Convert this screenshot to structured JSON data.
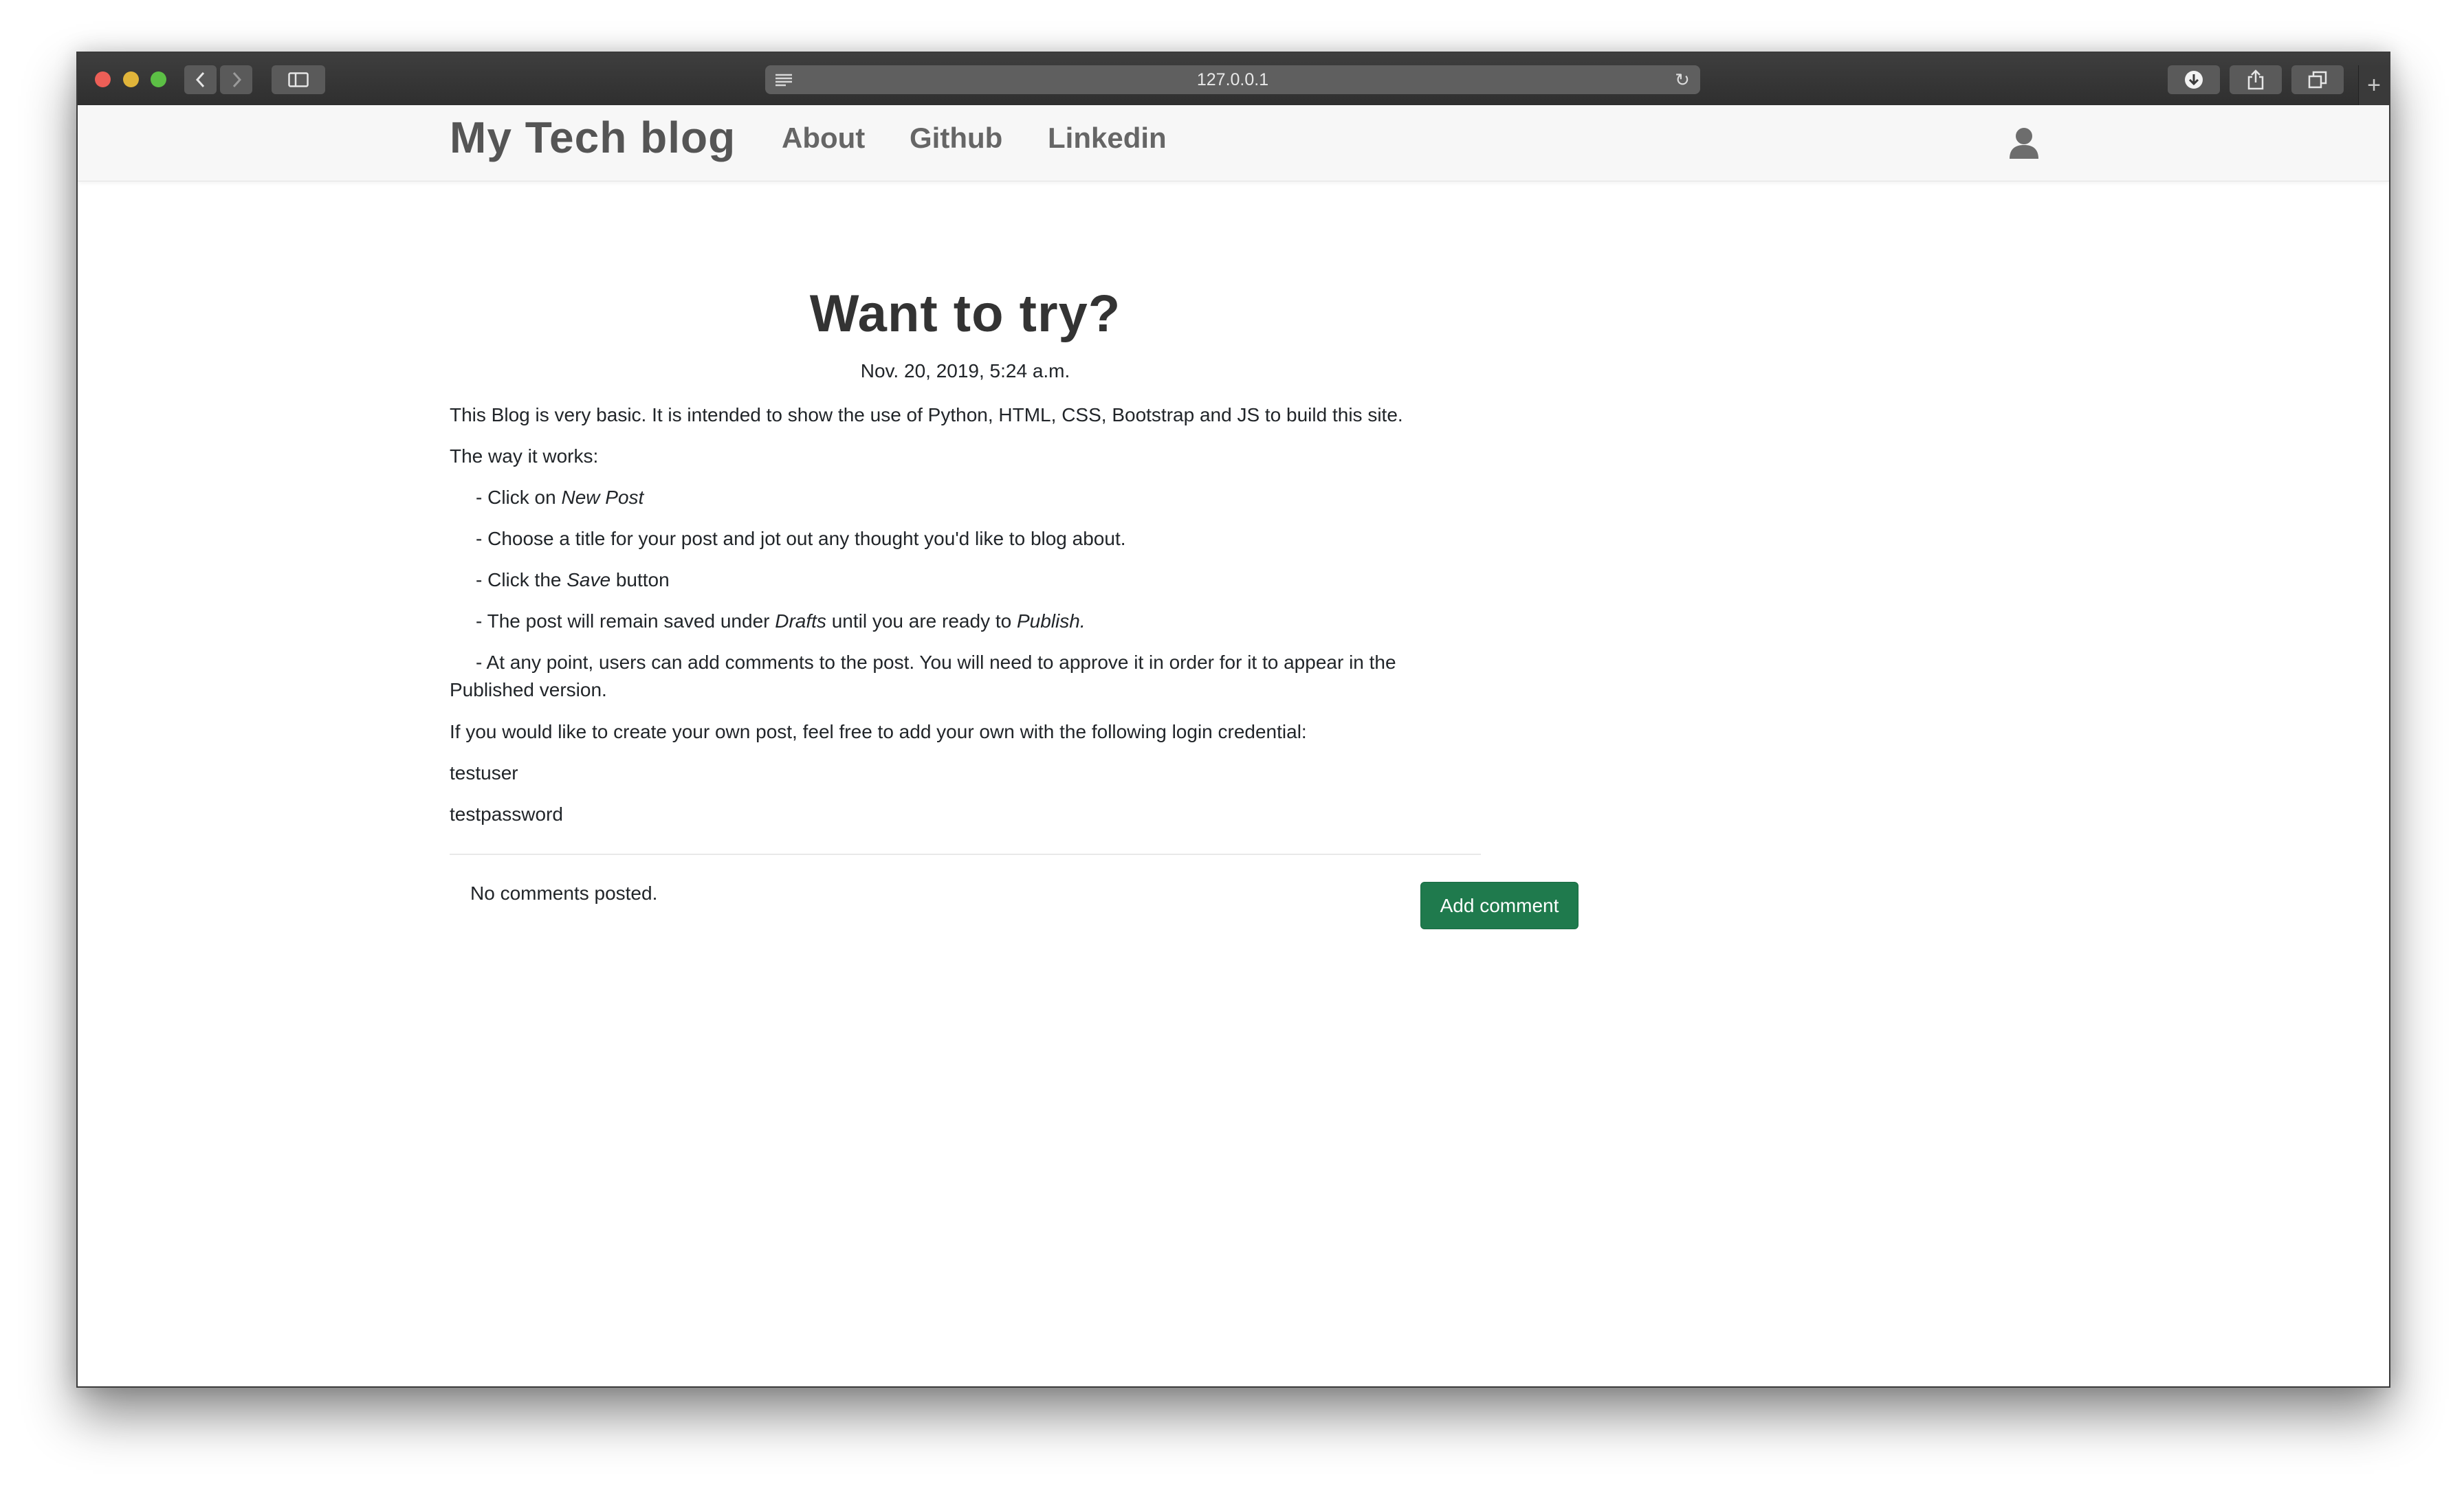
{
  "browser": {
    "url": "127.0.0.1",
    "icons": {
      "back": "chevron-left-icon",
      "forward": "chevron-right-icon",
      "sidebar": "sidebar-icon",
      "reader": "reader-icon",
      "reload": "reload-icon",
      "download": "download-icon",
      "share": "share-icon",
      "tabs": "tabs-icon",
      "new_tab": "plus-icon"
    }
  },
  "navbar": {
    "brand": "My Tech blog",
    "links": [
      "About",
      "Github",
      "Linkedin"
    ],
    "user_icon": "user-icon"
  },
  "post": {
    "title": "Want to try?",
    "date": "Nov. 20, 2019, 5:24 a.m.",
    "intro": "This Blog is very basic. It is intended to show the use of Python, HTML, CSS, Bootstrap and JS  to build this site.",
    "how_label": "The way it works:",
    "step1_pre": "- Click on ",
    "step1_em": "New Post",
    "step2": "- Choose a title for your post and jot out any thought you'd like to blog about.",
    "step3_pre": "- Click the ",
    "step3_em": "Save",
    "step3_post": " button",
    "step4_pre": "- The post will remain saved under ",
    "step4_em1": "Drafts",
    "step4_mid": " until you are ready to ",
    "step4_em2": "Publish.",
    "step5_line1": "-  At any point, users can add comments to the post. You will need to approve it in order for it to appear in the",
    "step5_line2": "Published version.",
    "credential_intro": "If you would like to create your own post, feel free to add your own with the following login credential:",
    "username": "testuser",
    "password": "testpassword"
  },
  "comments": {
    "empty_text": "No comments posted.",
    "add_button": "Add comment",
    "accent_color": "#1f7a4d"
  }
}
